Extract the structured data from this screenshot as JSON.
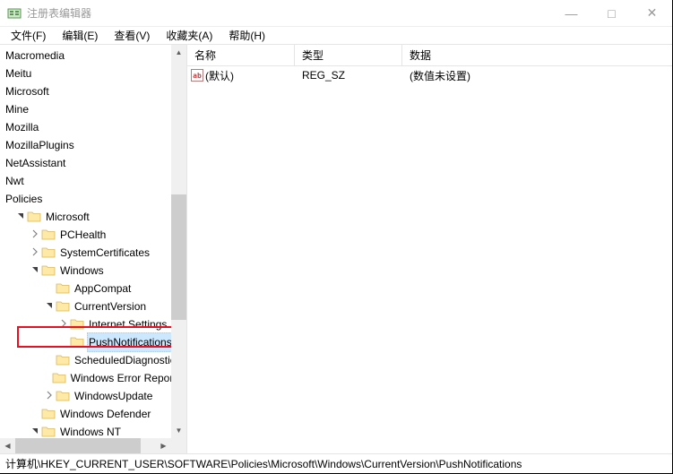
{
  "window": {
    "title": "注册表编辑器"
  },
  "menu": {
    "file": "文件(F)",
    "edit": "编辑(E)",
    "view": "查看(V)",
    "favorites": "收藏夹(A)",
    "help": "帮助(H)"
  },
  "tree_items": [
    {
      "indent": 0,
      "arrow": "",
      "label": "Macromedia"
    },
    {
      "indent": 0,
      "arrow": "",
      "label": "Meitu"
    },
    {
      "indent": 0,
      "arrow": "",
      "label": "Microsoft"
    },
    {
      "indent": 0,
      "arrow": "",
      "label": "Mine"
    },
    {
      "indent": 0,
      "arrow": "",
      "label": "Mozilla"
    },
    {
      "indent": 0,
      "arrow": "",
      "label": "MozillaPlugins"
    },
    {
      "indent": 0,
      "arrow": "",
      "label": "NetAssistant"
    },
    {
      "indent": 0,
      "arrow": "",
      "label": "Nwt"
    },
    {
      "indent": 0,
      "arrow": "",
      "label": "Policies"
    },
    {
      "indent": 1,
      "arrow": "expanded",
      "label": "Microsoft"
    },
    {
      "indent": 2,
      "arrow": "collapsed",
      "label": "PCHealth"
    },
    {
      "indent": 2,
      "arrow": "collapsed",
      "label": "SystemCertificates"
    },
    {
      "indent": 2,
      "arrow": "expanded",
      "label": "Windows"
    },
    {
      "indent": 3,
      "arrow": "",
      "label": "AppCompat"
    },
    {
      "indent": 3,
      "arrow": "expanded",
      "label": "CurrentVersion"
    },
    {
      "indent": 4,
      "arrow": "collapsed",
      "label": "Internet Settings"
    },
    {
      "indent": 4,
      "arrow": "",
      "label": "PushNotifications",
      "selected": true
    },
    {
      "indent": 3,
      "arrow": "",
      "label": "ScheduledDiagnostics"
    },
    {
      "indent": 3,
      "arrow": "",
      "label": "Windows Error Reportin"
    },
    {
      "indent": 3,
      "arrow": "collapsed",
      "label": "WindowsUpdate"
    },
    {
      "indent": 2,
      "arrow": "",
      "label": "Windows Defender"
    },
    {
      "indent": 2,
      "arrow": "expanded",
      "label": "Windows NT"
    }
  ],
  "columns": {
    "name": "名称",
    "type": "类型",
    "data": "数据"
  },
  "rows": [
    {
      "icon": "ab",
      "name": "(默认)",
      "type": "REG_SZ",
      "data": "(数值未设置)"
    }
  ],
  "status": {
    "path": "计算机\\HKEY_CURRENT_USER\\SOFTWARE\\Policies\\Microsoft\\Windows\\CurrentVersion\\PushNotifications"
  }
}
